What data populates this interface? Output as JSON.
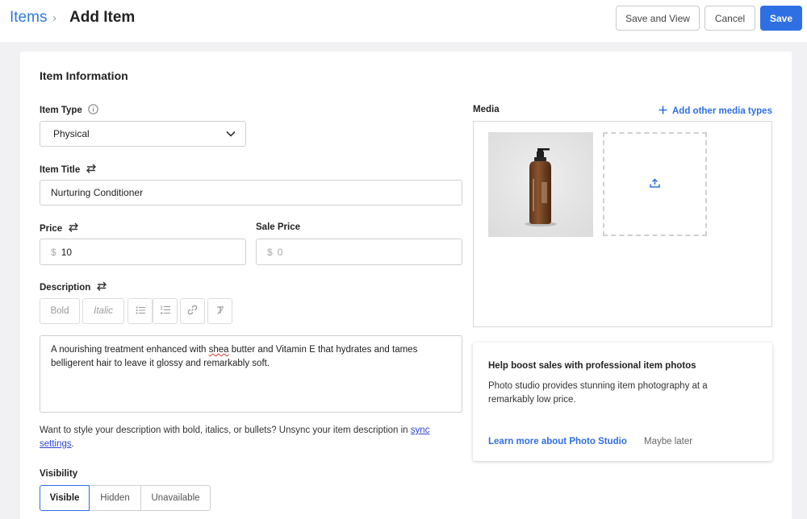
{
  "header": {
    "breadcrumb_parent": "Items",
    "breadcrumb_separator": "›",
    "title": "Add Item",
    "save_and_view_label": "Save and View",
    "cancel_label": "Cancel",
    "save_label": "Save"
  },
  "form": {
    "section_title": "Item Information",
    "item_type": {
      "label": "Item Type",
      "value": "Physical"
    },
    "item_title": {
      "label": "Item Title",
      "value": "Nurturing Conditioner"
    },
    "price": {
      "label": "Price",
      "currency": "$",
      "value": "10"
    },
    "sale_price": {
      "label": "Sale Price",
      "currency": "$",
      "placeholder": "0"
    },
    "description": {
      "label": "Description",
      "toolbar": {
        "bold": "Bold",
        "italic": "Italic"
      },
      "text_before": "A nourishing treatment enhanced with ",
      "text_misspelled": "shea",
      "text_after": " butter and Vitamin E that hydrates and tames belligerent hair to leave it glossy and remarkably soft."
    },
    "sync_note": {
      "text": "Want to style your description with bold, italics, or bullets? Unsync your item description in ",
      "link": "sync settings",
      "end": "."
    },
    "visibility": {
      "label": "Visibility",
      "options": [
        "Visible",
        "Hidden",
        "Unavailable"
      ],
      "selected": "Visible"
    }
  },
  "media": {
    "label": "Media",
    "add_other_label": "Add other media types",
    "thumbnail_icon": "product-bottle-image",
    "upload_icon": "upload-icon"
  },
  "promo": {
    "title": "Help boost sales with professional item photos",
    "body": "Photo studio provides stunning item photography at a remarkably low price.",
    "learn_more": "Learn more about Photo Studio",
    "maybe_later": "Maybe later"
  },
  "colors": {
    "accent": "#2f6fe4",
    "breadcrumb_link": "#2f7bd6",
    "background": "#f1f1f3"
  }
}
